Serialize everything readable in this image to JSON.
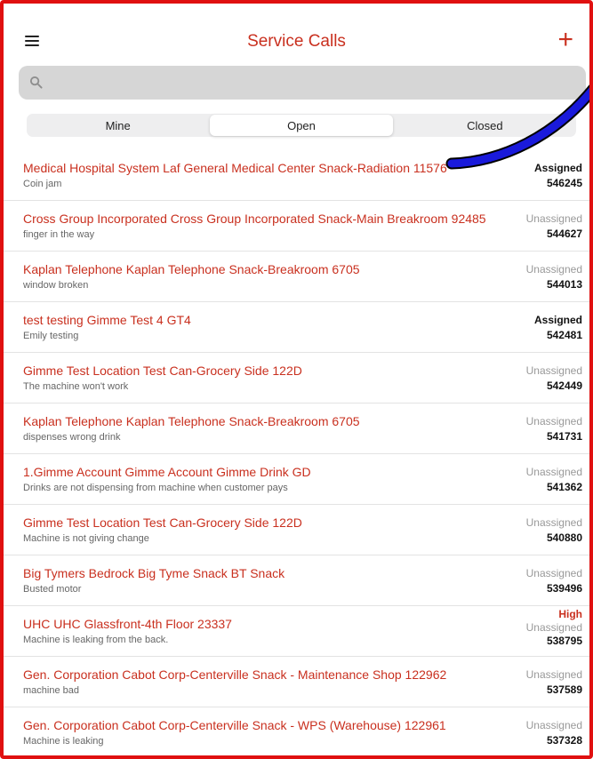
{
  "header": {
    "title": "Service Calls",
    "menu_icon": "hamburger-menu-icon",
    "add_icon": "plus-icon"
  },
  "search": {
    "placeholder": "",
    "value": ""
  },
  "tabs": [
    {
      "label": "Mine",
      "active": false
    },
    {
      "label": "Open",
      "active": true
    },
    {
      "label": "Closed",
      "active": false
    }
  ],
  "calls": [
    {
      "name": "Medical Hospital System Laf General Medical Center Snack-Radiation 11576",
      "description": "Coin jam",
      "priority": "",
      "status": "Assigned",
      "number": "546245"
    },
    {
      "name": "Cross Group Incorporated Cross Group Incorporated Snack-Main Breakroom 92485",
      "description": "finger in the way",
      "priority": "",
      "status": "Unassigned",
      "number": "544627"
    },
    {
      "name": "Kaplan Telephone Kaplan Telephone Snack-Breakroom 6705",
      "description": "window broken",
      "priority": "",
      "status": "Unassigned",
      "number": "544013"
    },
    {
      "name": "test testing Gimme Test 4 GT4",
      "description": "Emily testing",
      "priority": "",
      "status": "Assigned",
      "number": "542481"
    },
    {
      "name": "Gimme Test Location Test Can-Grocery Side 122D",
      "description": "The machine won't work",
      "priority": "",
      "status": "Unassigned",
      "number": "542449"
    },
    {
      "name": "Kaplan Telephone Kaplan Telephone Snack-Breakroom 6705",
      "description": "dispenses wrong drink",
      "priority": "",
      "status": "Unassigned",
      "number": "541731"
    },
    {
      "name": "1.Gimme Account  Gimme Account  Gimme Drink GD",
      "description": "Drinks are not dispensing from machine when customer pays",
      "priority": "",
      "status": "Unassigned",
      "number": "541362"
    },
    {
      "name": "Gimme Test Location Test Can-Grocery Side 122D",
      "description": "Machine is not giving change",
      "priority": "",
      "status": "Unassigned",
      "number": "540880"
    },
    {
      "name": "Big Tymers Bedrock Big Tyme Snack BT Snack",
      "description": "Busted motor",
      "priority": "",
      "status": "Unassigned",
      "number": "539496"
    },
    {
      "name": "UHC UHC Glassfront-4th Floor 23337",
      "description": "Machine is leaking from the back.",
      "priority": "High",
      "status": "Unassigned",
      "number": "538795"
    },
    {
      "name": "Gen. Corporation Cabot Corp-Centerville Snack - Maintenance Shop 122962",
      "description": "machine bad",
      "priority": "",
      "status": "Unassigned",
      "number": "537589"
    },
    {
      "name": "Gen. Corporation Cabot Corp-Centerville Snack - WPS (Warehouse) 122961",
      "description": "Machine is leaking",
      "priority": "",
      "status": "Unassigned",
      "number": "537328"
    }
  ],
  "colors": {
    "accent": "#c9301f",
    "frame": "#e01010",
    "annotation_arrow": "#1a1adb"
  }
}
